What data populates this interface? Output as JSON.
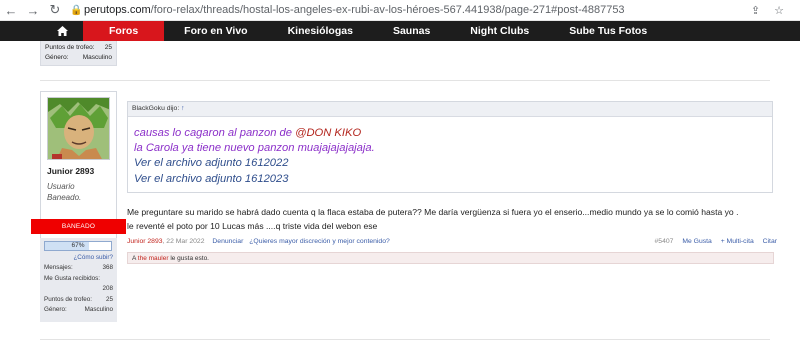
{
  "browser": {
    "url_host": "perutops.com",
    "url_path": "/foro-relax/threads/hostal-los-angeles-ex-rubi-av-los-héroes-567.441938/page-271#post-4887753"
  },
  "nav": {
    "items": [
      "Foros",
      "Foro en Vivo",
      "Kinesiólogas",
      "Saunas",
      "Night Clubs",
      "Sube Tus Fotos"
    ]
  },
  "prev_user": {
    "rows": [
      {
        "k": "Puntos de trofeo:",
        "v": "25"
      },
      {
        "k": "Género:",
        "v": "Masculino"
      }
    ]
  },
  "user": {
    "name": "Junior 2893",
    "title": "Usuario Baneado.",
    "banned_label": "BANEADO",
    "level_text": "67%",
    "level_value": 0.67,
    "howto": "¿Cómo subir?",
    "messages_label": "Mensajes:",
    "messages_value": "368",
    "likes_label": "Me Gusta recibidos:",
    "likes_value": "208",
    "trophy_label": "Puntos de trofeo:",
    "trophy_value": "25",
    "gender_label": "Género:",
    "gender_value": "Masculino"
  },
  "quote": {
    "author": "BlackGoku dijo:",
    "arrow": "↑",
    "line1_text": "causas lo cagaron al panzon de ",
    "line1_mention": "@DON KIKO",
    "line2": "la Carola ya tiene nuevo panzon muajajajajajaja.",
    "line3": "Ver el archivo adjunto 1612022",
    "line4": "Ver el archivo adjunto 1612023"
  },
  "message": {
    "line1": "Me preguntare su marido se habrá dado cuenta q la flaca estaba de putera?? Me daría vergüenza si fuera yo el enserio...medio mundo ya se lo comió hasta yo .",
    "line2": "le reventé el poto por 10 Lucas más ....q triste vida del webon ese"
  },
  "meta": {
    "author": "Junior 2893",
    "date": ", 22 Mar 2022",
    "report": "Denunciar",
    "promo": "¿Quieres mayor discreción y mejor contenido?",
    "post_number": "#5407",
    "like": "Me Gusta",
    "multiquote": "+ Multi-cita",
    "quote": "Citar"
  },
  "likes": {
    "prefix": "A ",
    "user": "the mauler",
    "suffix": " le gusta esto."
  },
  "colors": {
    "nav_bg": "#1d1d1d",
    "nav_active": "#d8161c",
    "banned": "#ef0000"
  }
}
